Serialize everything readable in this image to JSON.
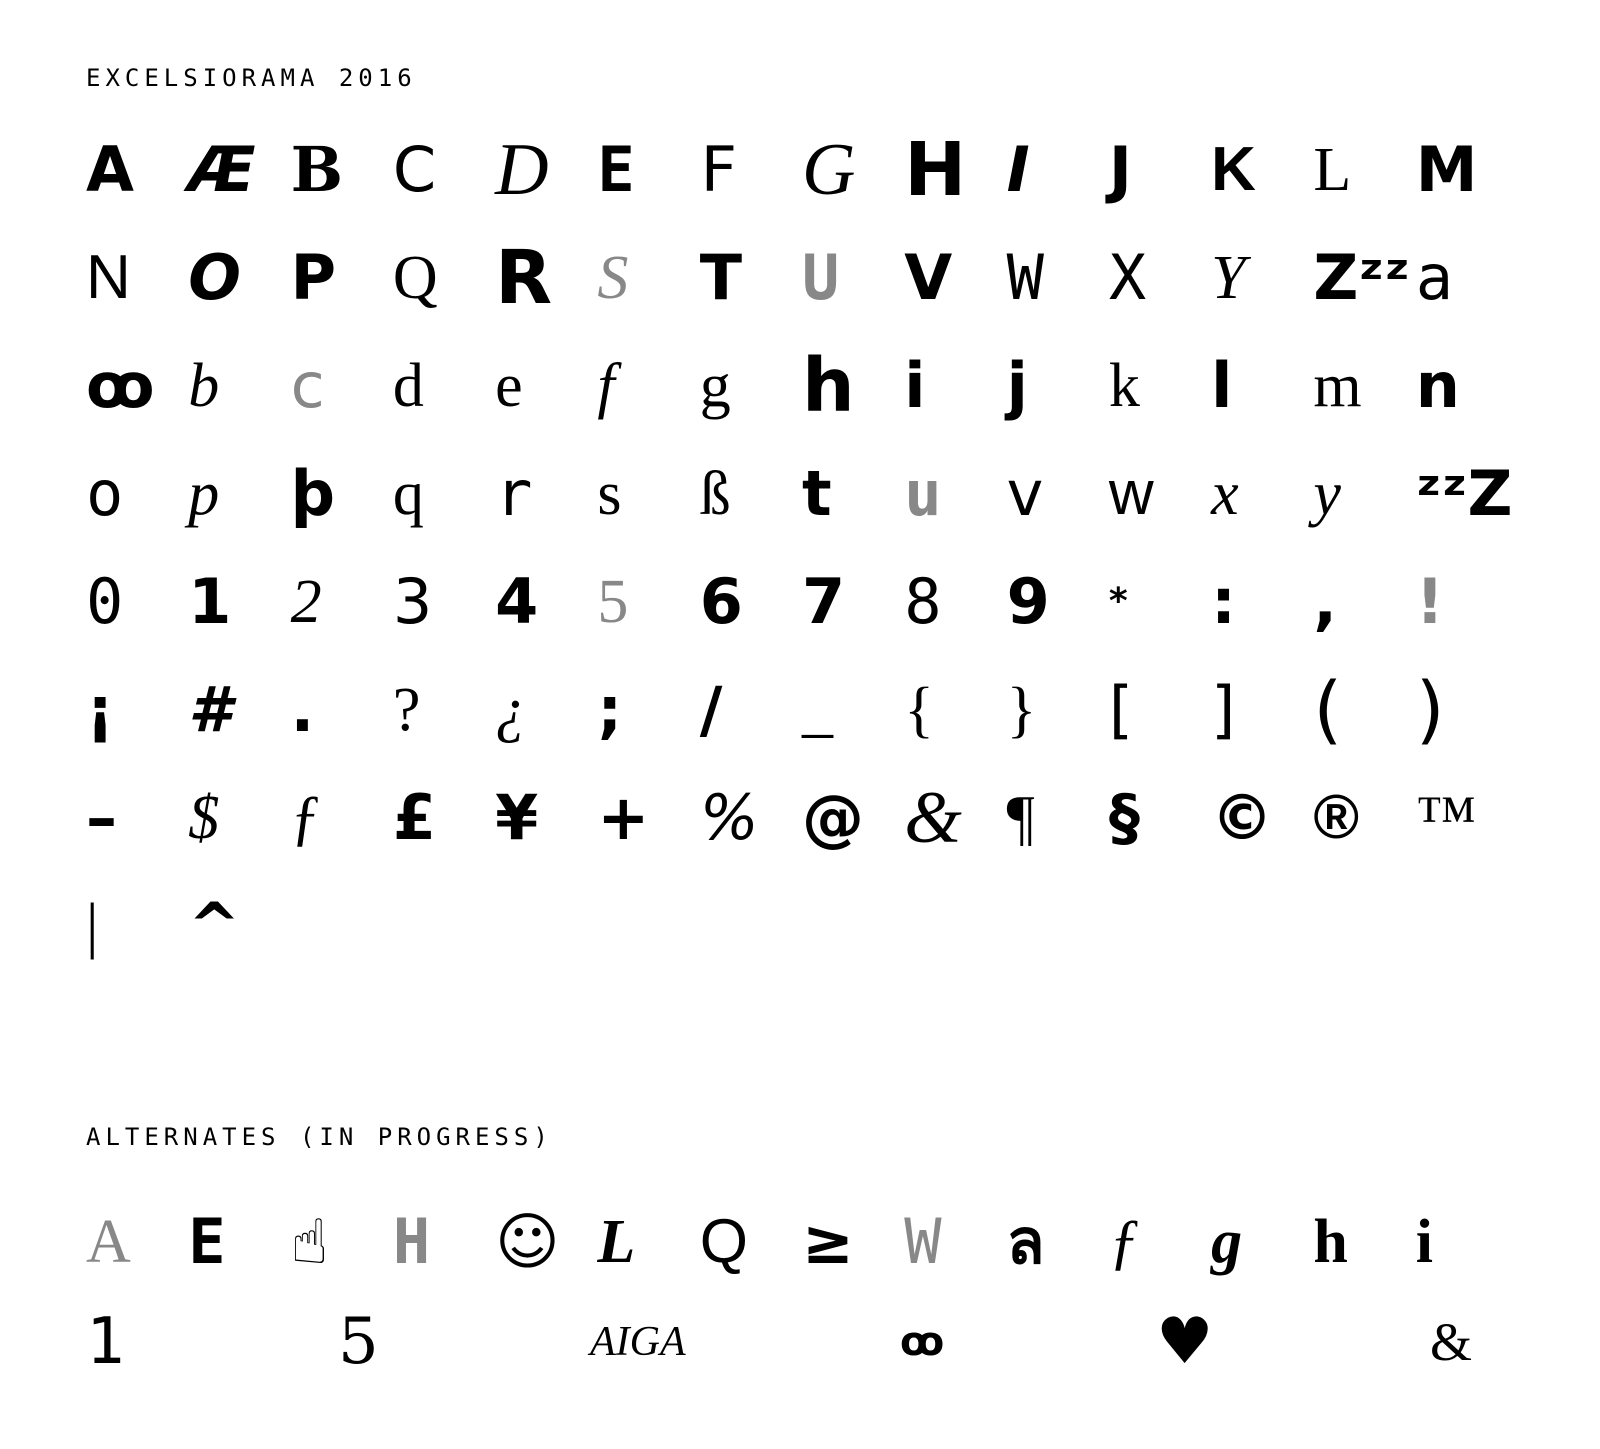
{
  "main_title": "EXCELSIORAMA 2016",
  "alternates_title": "ALTERNATES (IN PROGRESS)",
  "glyphs": [
    "A",
    "Æ",
    "B",
    "C",
    "D",
    "E",
    "F",
    "G",
    "H",
    "I",
    "J",
    "K",
    "L",
    "M",
    "N",
    "O",
    "P",
    "Q",
    "R",
    "S",
    "T",
    "U",
    "V",
    "W",
    "X",
    "Y",
    "Zᶻᶻ",
    "a",
    "ꝏ",
    "b",
    "c",
    "d",
    "e",
    "f",
    "g",
    "h",
    "i",
    "j",
    "k",
    "l",
    "m",
    "n",
    "o",
    "p",
    "þ",
    "q",
    "r",
    "s",
    "ß",
    "t",
    "u",
    "v",
    "w",
    "x",
    "y",
    "ᶻᶻZ",
    "0",
    "1",
    "2",
    "3",
    "4",
    "5",
    "6",
    "7",
    "8",
    "9",
    "*",
    ":",
    ",",
    "!",
    "¡",
    "#",
    ".",
    "?",
    "¿",
    ";",
    "/",
    "_",
    "{",
    "}",
    "[",
    "]",
    "(",
    ")",
    "–",
    "$",
    "ƒ",
    "£",
    "¥",
    "+",
    "%",
    "@",
    "&",
    "¶",
    "§",
    "©",
    "®",
    "™",
    "|",
    "^"
  ],
  "alternates_row1": [
    "A",
    "E",
    "☝",
    "H",
    "☺",
    "L",
    "Q",
    "≥",
    "W",
    "ล",
    "ƒ",
    "g",
    "h",
    "i"
  ],
  "alternates_row2": [
    "1",
    "5",
    "AIGA",
    "ꝏ",
    "♥",
    "&"
  ]
}
